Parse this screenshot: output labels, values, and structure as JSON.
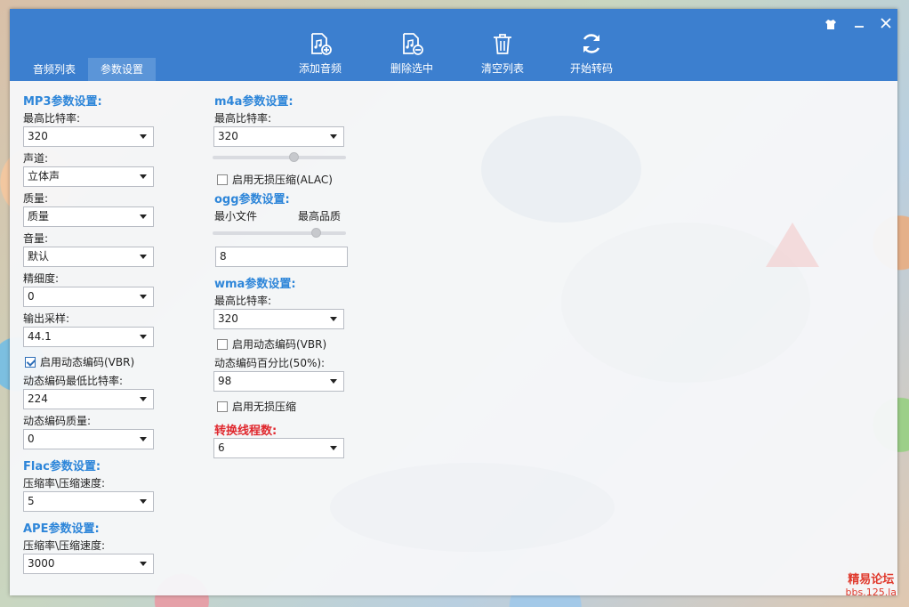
{
  "tabs": [
    {
      "label": "音频列表"
    },
    {
      "label": "参数设置"
    }
  ],
  "toolbar": {
    "add": "添加音频",
    "delete": "删除选中",
    "clear": "清空列表",
    "start": "开始转码"
  },
  "window_buttons": {
    "skin": "shirt-icon",
    "minimize": "minimize-icon",
    "close": "close-icon"
  },
  "mp3": {
    "title": "MP3参数设置:",
    "bitrate_label": "最高比特率:",
    "bitrate": "320",
    "channel_label": "声道:",
    "channel": "立体声",
    "quality_label": "质量:",
    "quality": "质量",
    "volume_label": "音量:",
    "volume": "默认",
    "precision_label": "精细度:",
    "precision": "0",
    "samplerate_label": "输出采样:",
    "samplerate": "44.1",
    "vbr_label": "启用动态编码(VBR)",
    "vbr_checked": true,
    "vbr_min_label": "动态编码最低比特率:",
    "vbr_min": "224",
    "vbr_quality_label": "动态编码质量:",
    "vbr_quality": "0"
  },
  "flac": {
    "title": "Flac参数设置:",
    "ratio_label": "压缩率\\压缩速度:",
    "ratio": "5"
  },
  "ape": {
    "title": "APE参数设置:",
    "ratio_label": "压缩率\\压缩速度:",
    "ratio": "3000"
  },
  "m4a": {
    "title": "m4a参数设置:",
    "bitrate_label": "最高比特率:",
    "bitrate": "320",
    "slider_level": 0.62,
    "alac_label": "启用无损压缩(ALAC)",
    "alac_checked": false
  },
  "ogg": {
    "title": "ogg参数设置:",
    "min_label": "最小文件",
    "max_label": "最高品质",
    "slider_level": 0.8,
    "value": "8"
  },
  "wma": {
    "title": "wma参数设置:",
    "bitrate_label": "最高比特率:",
    "bitrate": "320",
    "vbr_label": "启用动态编码(VBR)",
    "vbr_checked": false,
    "vbr_percent_label": "动态编码百分比(50%):",
    "vbr_percent": "98",
    "lossless_label": "启用无损压缩",
    "lossless_checked": false
  },
  "threads": {
    "title": "转换线程数:",
    "value": "6"
  },
  "watermark": {
    "line1": "精易论坛",
    "line2": "bbs.125.la"
  },
  "colors": {
    "titlebar": "#3c7fcf",
    "section": "#2e86d9",
    "threads_title": "#e0282e"
  }
}
